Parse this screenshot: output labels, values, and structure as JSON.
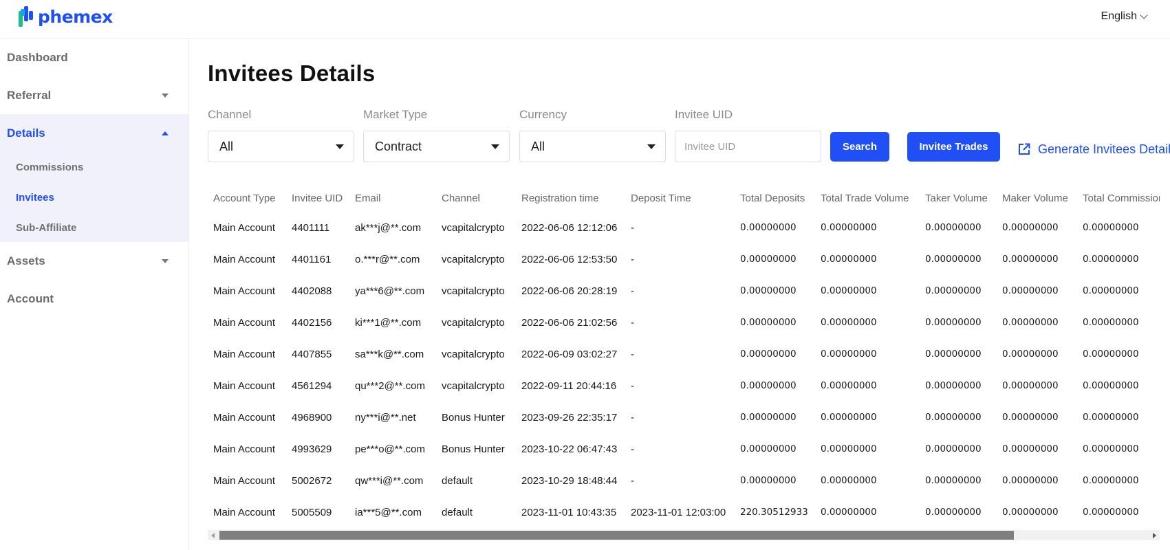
{
  "header": {
    "brand": "phemex",
    "language": "English"
  },
  "sidebar": {
    "items": [
      {
        "label": "Dashboard"
      },
      {
        "label": "Referral"
      },
      {
        "label": "Details"
      },
      {
        "label": "Assets"
      },
      {
        "label": "Account"
      }
    ],
    "details_sub": [
      {
        "label": "Commissions"
      },
      {
        "label": "Invitees"
      },
      {
        "label": "Sub-Affiliate"
      }
    ]
  },
  "page": {
    "title": "Invitees Details"
  },
  "filters": {
    "channel": {
      "label": "Channel",
      "value": "All"
    },
    "market_type": {
      "label": "Market Type",
      "value": "Contract"
    },
    "currency": {
      "label": "Currency",
      "value": "All"
    },
    "invitee_uid": {
      "label": "Invitee UID",
      "placeholder": "Invitee UID",
      "value": ""
    }
  },
  "actions": {
    "search": "Search",
    "invitee_trades": "Invitee Trades",
    "generate": "Generate Invitees Details"
  },
  "table": {
    "columns": [
      "Account Type",
      "Invitee UID",
      "Email",
      "Channel",
      "Registration time",
      "Deposit Time",
      "Total Deposits",
      "Total Trade Volume",
      "Taker Volume",
      "Maker Volume",
      "Total Commission"
    ],
    "rows": [
      [
        "Main Account",
        "4401111",
        "ak***j@**.com",
        "vcapitalcrypto",
        "2022-06-06 12:12:06",
        "-",
        "0.00000000",
        "0.00000000",
        "0.00000000",
        "0.00000000",
        "0.00000000"
      ],
      [
        "Main Account",
        "4401161",
        "o.***r@**.com",
        "vcapitalcrypto",
        "2022-06-06 12:53:50",
        "-",
        "0.00000000",
        "0.00000000",
        "0.00000000",
        "0.00000000",
        "0.00000000"
      ],
      [
        "Main Account",
        "4402088",
        "ya***6@**.com",
        "vcapitalcrypto",
        "2022-06-06 20:28:19",
        "-",
        "0.00000000",
        "0.00000000",
        "0.00000000",
        "0.00000000",
        "0.00000000"
      ],
      [
        "Main Account",
        "4402156",
        "ki***1@**.com",
        "vcapitalcrypto",
        "2022-06-06 21:02:56",
        "-",
        "0.00000000",
        "0.00000000",
        "0.00000000",
        "0.00000000",
        "0.00000000"
      ],
      [
        "Main Account",
        "4407855",
        "sa***k@**.com",
        "vcapitalcrypto",
        "2022-06-09 03:02:27",
        "-",
        "0.00000000",
        "0.00000000",
        "0.00000000",
        "0.00000000",
        "0.00000000"
      ],
      [
        "Main Account",
        "4561294",
        "qu***2@**.com",
        "vcapitalcrypto",
        "2022-09-11 20:44:16",
        "-",
        "0.00000000",
        "0.00000000",
        "0.00000000",
        "0.00000000",
        "0.00000000"
      ],
      [
        "Main Account",
        "4968900",
        "ny***i@**.net",
        "Bonus Hunter",
        "2023-09-26 22:35:17",
        "-",
        "0.00000000",
        "0.00000000",
        "0.00000000",
        "0.00000000",
        "0.00000000"
      ],
      [
        "Main Account",
        "4993629",
        "pe***o@**.com",
        "Bonus Hunter",
        "2023-10-22 06:47:43",
        "-",
        "0.00000000",
        "0.00000000",
        "0.00000000",
        "0.00000000",
        "0.00000000"
      ],
      [
        "Main Account",
        "5002672",
        "qw***i@**.com",
        "default",
        "2023-10-29 18:48:44",
        "-",
        "0.00000000",
        "0.00000000",
        "0.00000000",
        "0.00000000",
        "0.00000000"
      ],
      [
        "Main Account",
        "5005509",
        "ia***5@**.com",
        "default",
        "2023-11-01 10:43:35",
        "2023-11-01 12:03:00",
        "220.30512933",
        "0.00000000",
        "0.00000000",
        "0.00000000",
        "0.00000000"
      ]
    ]
  },
  "colors": {
    "accent": "#1f4ff5",
    "sidebar_active_bg": "#f1f1fb"
  }
}
